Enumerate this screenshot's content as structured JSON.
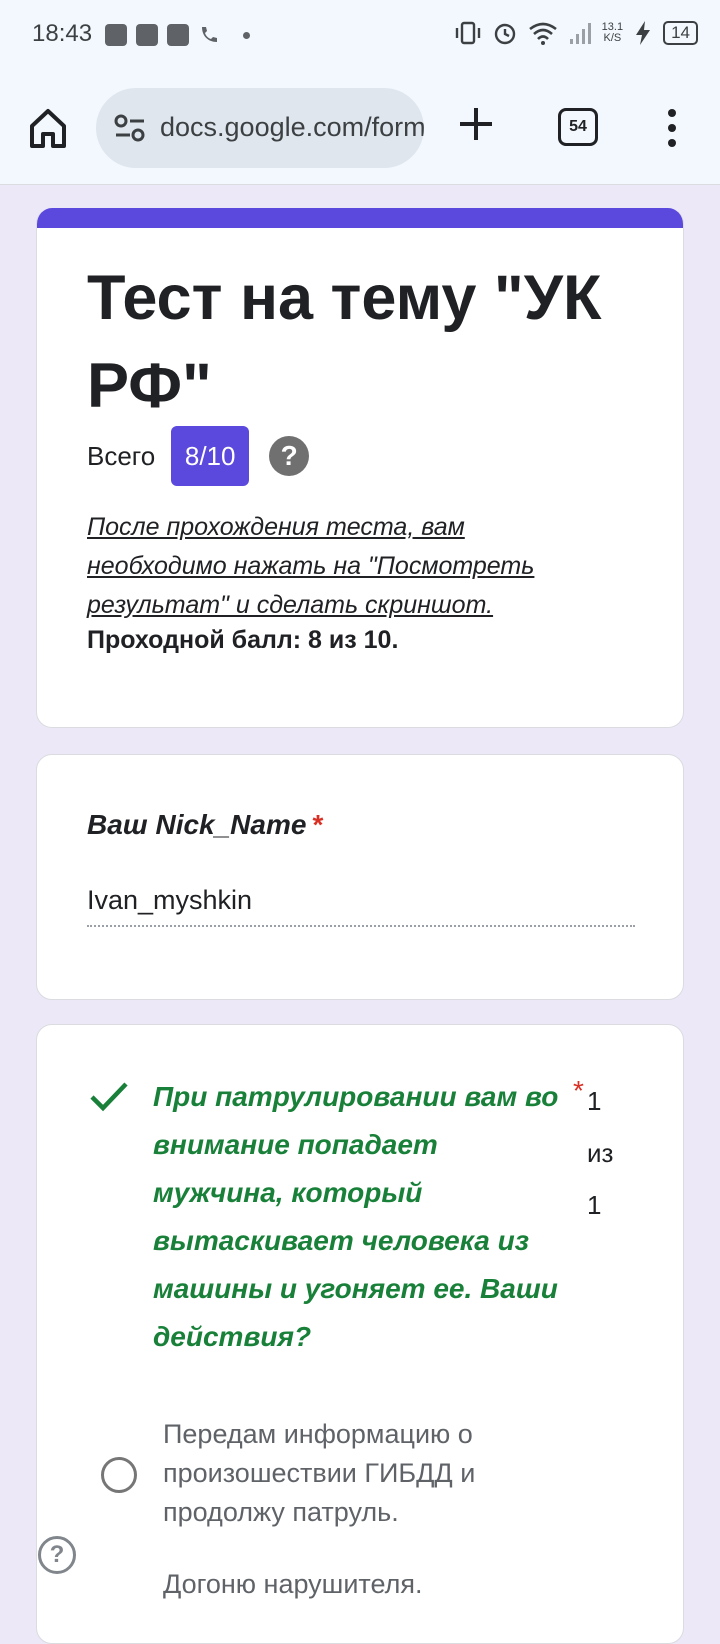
{
  "status_bar": {
    "time": "18:43",
    "net_speed": "13.1",
    "net_unit": "K/S",
    "battery": "14"
  },
  "browser": {
    "url": "docs.google.com/forms",
    "tab_count": "54"
  },
  "form": {
    "title": "Тест на тему \"УК РФ\"",
    "score_label": "Всего",
    "score": "8/10",
    "help_glyph": "?",
    "description": "После прохождения теста, вам необходимо нажать на \"Посмотреть результат\" и сделать скриншот.",
    "passing_score": "Проходной балл: 8 из 10.",
    "accent_color": "#5b48dd"
  },
  "nick_question": {
    "label": "Ваш Nick_Name",
    "required_mark": "*",
    "answer": "Ivan_myshkin"
  },
  "question_1": {
    "text": "При патрулировании вам во внимание попадает мужчина, который вытаскивает человека из машины и угоняет ее. Ваши действия?",
    "required_mark": "*",
    "points": "1 из 1",
    "status": "correct",
    "options": [
      {
        "label": "Передам информацию о произошествии ГИБДД и продолжу патруль."
      },
      {
        "label": "Догоню нарушителя."
      }
    ]
  },
  "floating_help": "?"
}
